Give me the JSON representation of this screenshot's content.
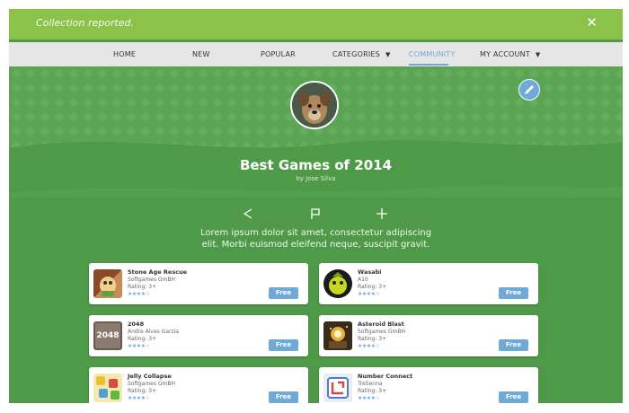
{
  "toast": {
    "message": "Collection reported.",
    "close_icon": "close-icon"
  },
  "nav": {
    "items": [
      {
        "label": "HOME"
      },
      {
        "label": "NEW"
      },
      {
        "label": "POPULAR"
      },
      {
        "label": "CATEGORIES"
      },
      {
        "label": "COMMUNITY",
        "active": true
      },
      {
        "label": "MY ACCOUNT"
      }
    ]
  },
  "collection": {
    "title": "Best Games of 2014",
    "byline": "by Jose Silva",
    "description_line1": "Lorem ipsum dolor sit amet, consectetur adipiscing",
    "description_line2": "elit. Morbi euismod eleifend neque, suscipit gravit."
  },
  "games": [
    {
      "name": "Stone Age Rescue",
      "developer": "Softgames GmBH",
      "rating": "Rating: 3+",
      "button": "Free",
      "stars": 4
    },
    {
      "name": "Wasabi",
      "developer": "A10",
      "rating": "Rating: 3+",
      "button": "Free",
      "stars": 4
    },
    {
      "name": "2048",
      "developer": "Andre Alves Garzia",
      "rating": "Rating: 3+",
      "button": "Free",
      "stars": 4,
      "thumb_text": "2048"
    },
    {
      "name": "Asteroid Blast",
      "developer": "Softgames GmBH",
      "rating": "Rating: 3+",
      "button": "Free",
      "stars": 4
    },
    {
      "name": "Jelly Collapse",
      "developer": "Softgames GmBH",
      "rating": "Rating: 3+",
      "button": "Free",
      "stars": 4
    },
    {
      "name": "Number Connect",
      "developer": "TreSenna",
      "rating": "Rating: 3+",
      "button": "Free",
      "stars": 4
    }
  ],
  "colors": {
    "background": "#4f9a48",
    "toast": "#8bc34a",
    "accent": "#6fa9d8"
  }
}
